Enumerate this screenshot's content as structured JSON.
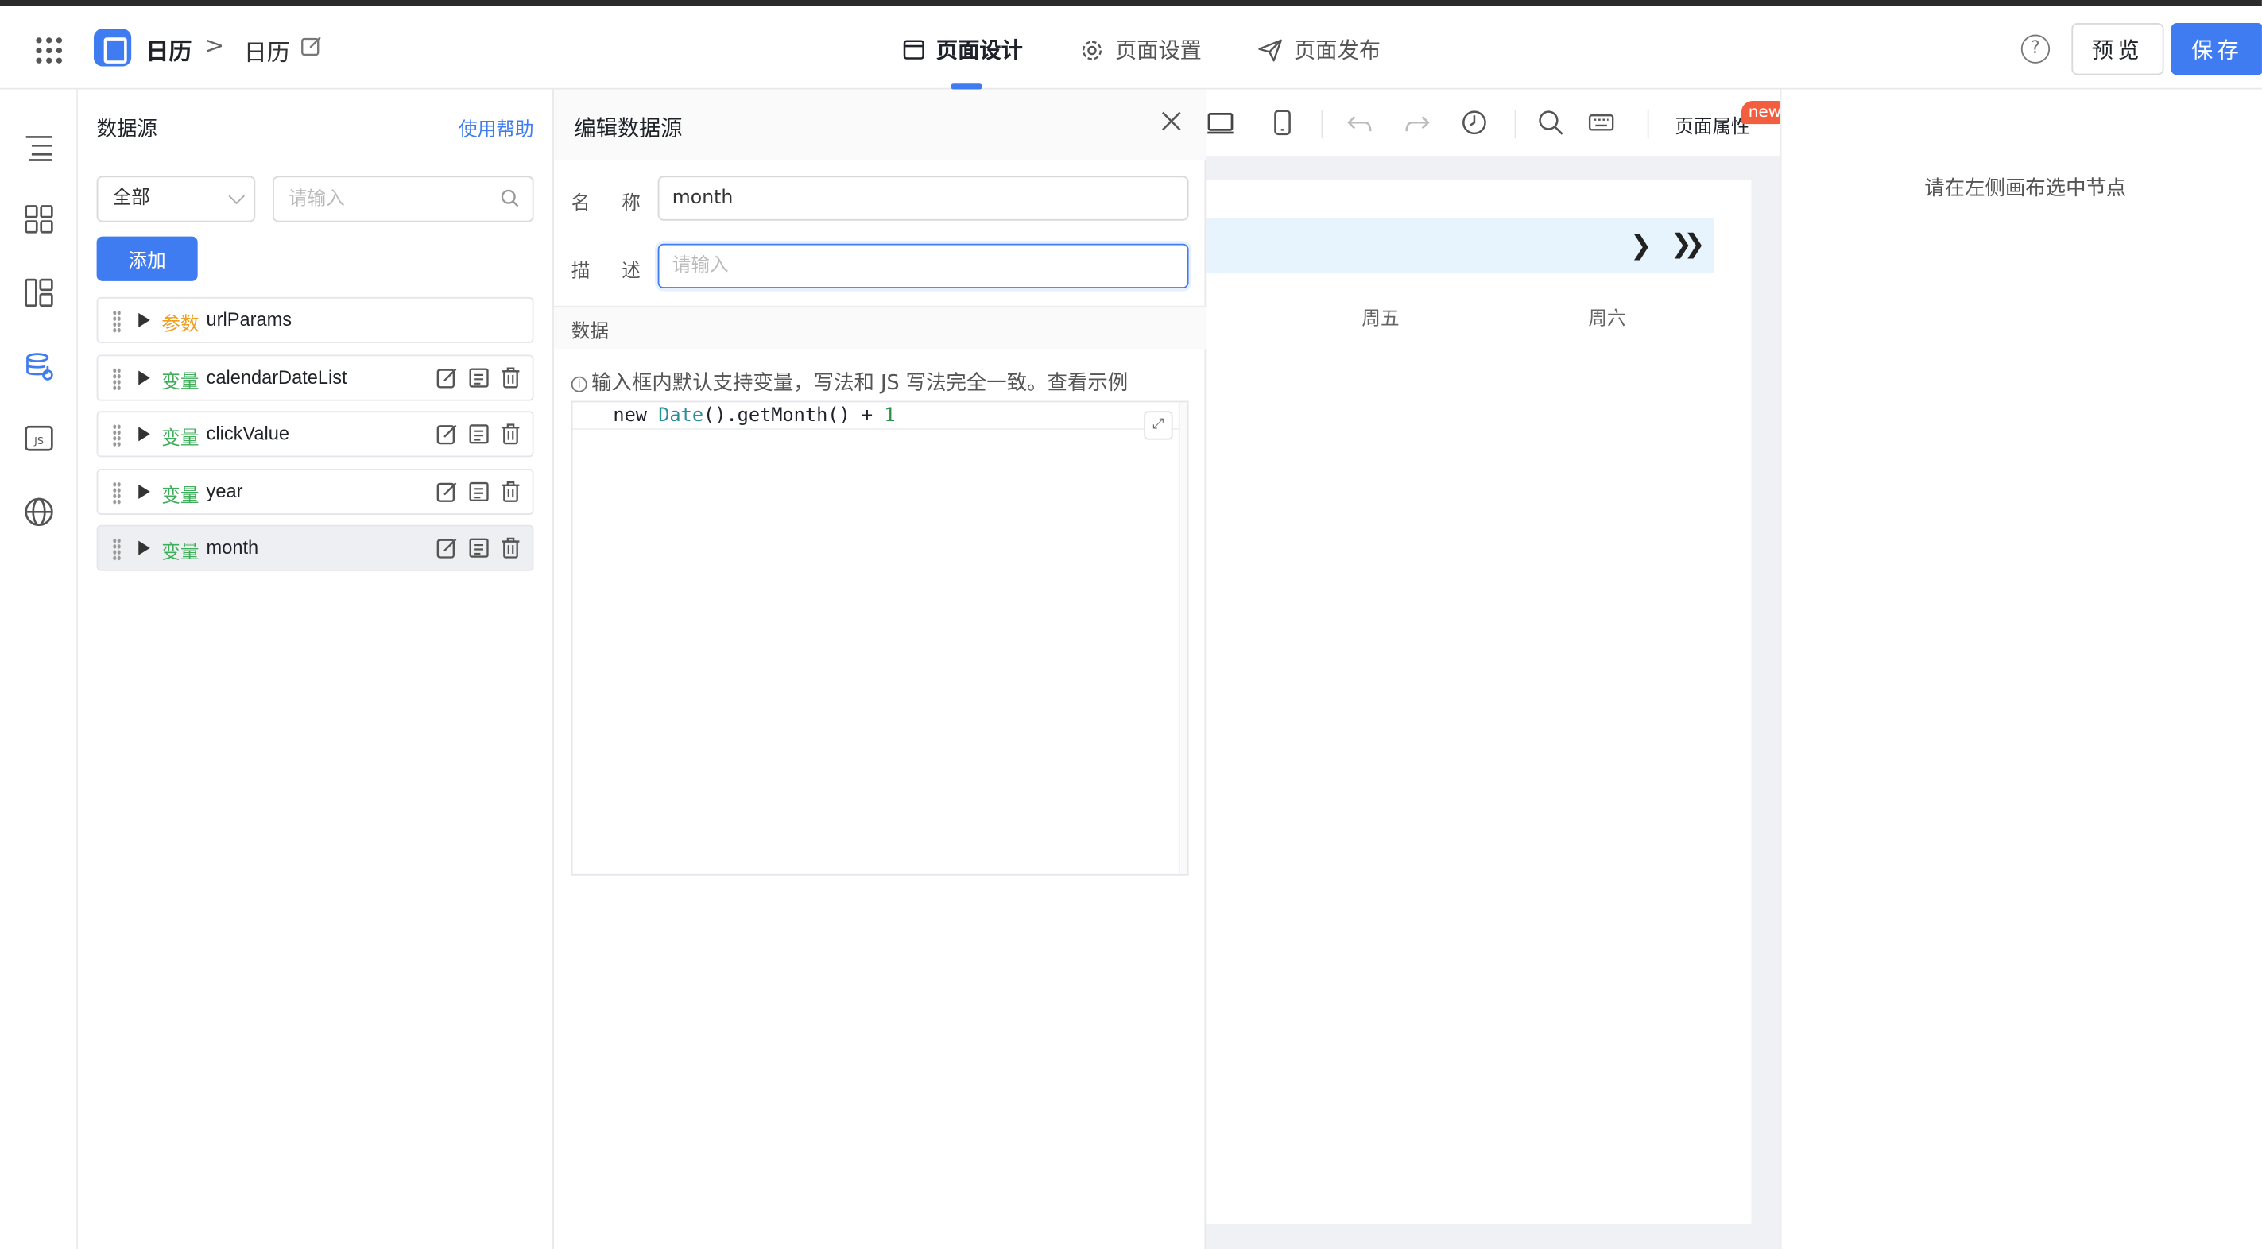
{
  "header": {
    "app_title": "日历",
    "crumb_separator": ">",
    "page_name": "日历",
    "tabs": [
      {
        "label": "页面设计",
        "active": true
      },
      {
        "label": "页面设置",
        "active": false
      },
      {
        "label": "页面发布",
        "active": false
      }
    ],
    "help_label": "?",
    "preview_label": "预览",
    "save_label": "保存"
  },
  "datasource": {
    "title": "数据源",
    "help_link": "使用帮助",
    "filter_value": "全部",
    "search_placeholder": "请输入",
    "add_label": "添加",
    "items": [
      {
        "kind": "参数",
        "kind_color": "#f0a020",
        "name": "urlParams",
        "actions": false,
        "selected": false
      },
      {
        "kind": "变量",
        "kind_color": "#3fae5a",
        "name": "calendarDateList",
        "actions": true,
        "selected": false
      },
      {
        "kind": "变量",
        "kind_color": "#3fae5a",
        "name": "clickValue",
        "actions": true,
        "selected": false
      },
      {
        "kind": "变量",
        "kind_color": "#3fae5a",
        "name": "year",
        "actions": true,
        "selected": false
      },
      {
        "kind": "变量",
        "kind_color": "#3fae5a",
        "name": "month",
        "actions": true,
        "selected": true
      }
    ]
  },
  "editor": {
    "title": "编辑数据源",
    "name_label": "名称",
    "name_value": "month",
    "desc_label": "描述",
    "desc_placeholder": "请输入",
    "data_section": "数据",
    "hint_icon": "i",
    "hint": "输入框内默认支持变量，写法和 JS 写法完全一致。查看示例",
    "code": {
      "kw": "new ",
      "cls": "Date",
      "rest": "().getMonth() + ",
      "num": "1"
    },
    "expand_icon": "⤢"
  },
  "canvas": {
    "page_attr_label": "页面属性",
    "new_badge": "new",
    "next_month": "❯",
    "next_year": "❯❯",
    "weekdays": [
      "周五",
      "周六"
    ]
  },
  "right_panel": {
    "hint": "请在左侧画布选中节点"
  },
  "colors": {
    "primary": "#3f7bf1",
    "badge": "#f35e3f",
    "calendar_header": "#e8f4fd",
    "param_kind": "#f0a020",
    "var_kind": "#3fae5a"
  }
}
